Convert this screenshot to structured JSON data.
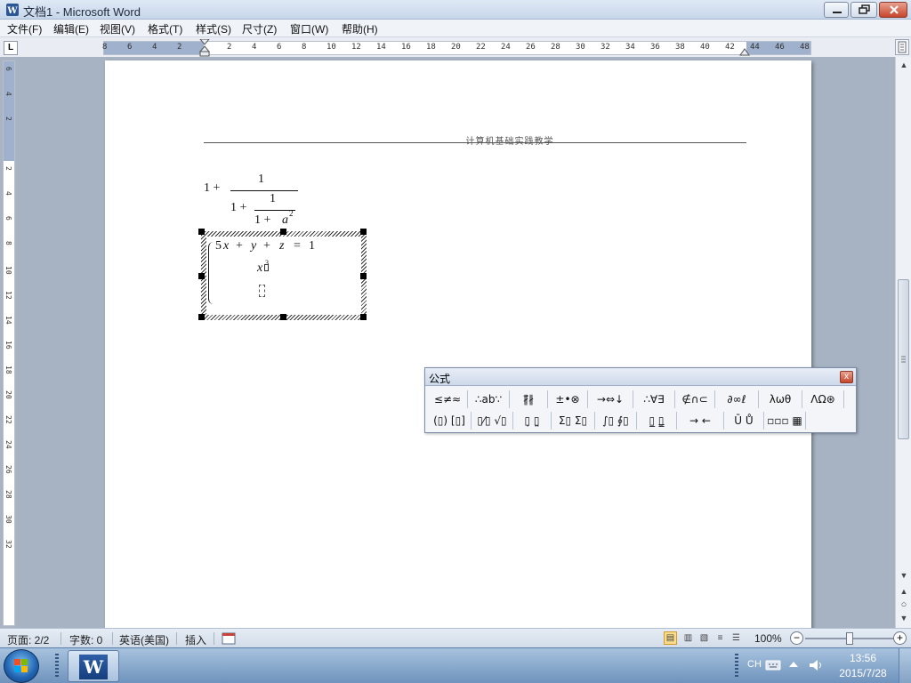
{
  "window": {
    "title": "文档1 - Microsoft Word"
  },
  "menu": [
    "文件(F)",
    "编辑(E)",
    "视图(V)",
    "格式(T)",
    "样式(S)",
    "尺寸(Z)",
    "窗口(W)",
    "帮助(H)"
  ],
  "ruler": {
    "tab_selector": "L",
    "h_ticks": [
      "8",
      "6",
      "4",
      "2",
      "",
      "2",
      "4",
      "6",
      "8",
      "10",
      "12",
      "14",
      "16",
      "18",
      "20",
      "22",
      "24",
      "26",
      "28",
      "30",
      "32",
      "34",
      "36",
      "38",
      "40",
      "42",
      "44",
      "46",
      "48"
    ],
    "v_ticks": [
      "6",
      "4",
      "2",
      "",
      "2",
      "4",
      "6",
      "8",
      "10",
      "12",
      "14",
      "16",
      "18",
      "20",
      "22",
      "24",
      "26",
      "28",
      "30",
      "32"
    ]
  },
  "document": {
    "header_text": "计算机基础实践教学",
    "formula1": {
      "lead": "1 +",
      "num": "1",
      "den_lead": "1 +",
      "den_num": "1",
      "den_den_lead": "1 +",
      "den_den_var": "a",
      "den_den_exp": "2"
    },
    "formula2": {
      "line1_coef": "5",
      "line1_x": "x",
      "line1_plus1": "+",
      "line1_y": "y",
      "line1_plus2": "+",
      "line1_z": "z",
      "line1_eq": "=",
      "line1_rhs": "1",
      "line2_var": "x",
      "line2_exp": "3"
    }
  },
  "equation_toolbar": {
    "title": "公式",
    "close": "x",
    "row1": [
      "≤≠≈",
      "∴ab∵",
      "∦⃗∦",
      "±•⊗",
      "→⇔↓",
      "∴∀∃",
      "∉∩⊂",
      "∂∞ℓ",
      "λωθ",
      "ΛΩ⊛"
    ],
    "row2": [
      "(▯) [▯]",
      "▯⁄▯ √▯",
      "▯̣ ▯̤",
      "Σ▯ Σ▯",
      "∫▯ ∮▯",
      "▯̲ ▯̳",
      "→ ←",
      "Ū Ů",
      "▫▫▫ ▦"
    ]
  },
  "statusbar": {
    "page": "页面: 2/2",
    "words": "字数: 0",
    "language": "英语(美国)",
    "insert": "插入",
    "zoom": "100%",
    "zoom_level": 0.5
  },
  "taskbar": {
    "lang": "CH",
    "time": "13:56",
    "date": "2015/7/28",
    "word_icon_letter": "W"
  }
}
